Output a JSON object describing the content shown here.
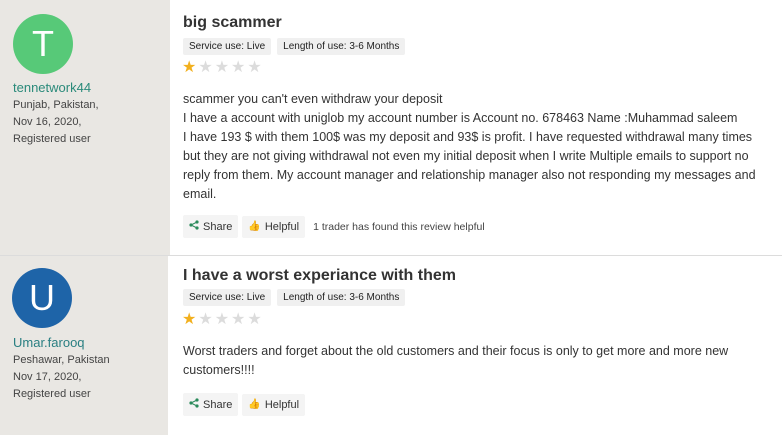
{
  "reviews": [
    {
      "avatar_letter": "T",
      "avatar_color": "#57c978",
      "username": "tennetwork44",
      "location": "Punjab, Pakistan,",
      "date": "Nov 16, 2020,",
      "role": "Registered user",
      "title": "big scammer",
      "tags": [
        "Service use: Live",
        "Length of use: 3-6 Months"
      ],
      "rating": 1,
      "body": [
        "scammer you can't even withdraw your deposit",
        "I have a account with uniglob my account number is Account no. 678463 Name :Muhammad saleem",
        "I have 193 $ with them 100$ was my deposit and 93$ is profit. I have requested withdrawal many times but they are not giving withdrawal not even my initial deposit when I write Multiple emails to support no reply from them. My account manager and relationship manager also not responding my messages and email."
      ],
      "share_label": "Share",
      "helpful_label": "Helpful",
      "helpful_count_text": "1 trader has found this review helpful"
    },
    {
      "avatar_letter": "U",
      "avatar_color": "#1e64a8",
      "username": "Umar.farooq",
      "location": "Peshawar, Pakistan",
      "date": "Nov 17, 2020,",
      "role": "Registered user",
      "title": "I have a worst experiance with them",
      "tags": [
        "Service use: Live",
        "Length of use: 3-6 Months"
      ],
      "rating": 1,
      "body": [
        "Worst traders and forget about the old customers and their focus is only to get more and more new customers!!!!"
      ],
      "share_label": "Share",
      "helpful_label": "Helpful"
    }
  ]
}
